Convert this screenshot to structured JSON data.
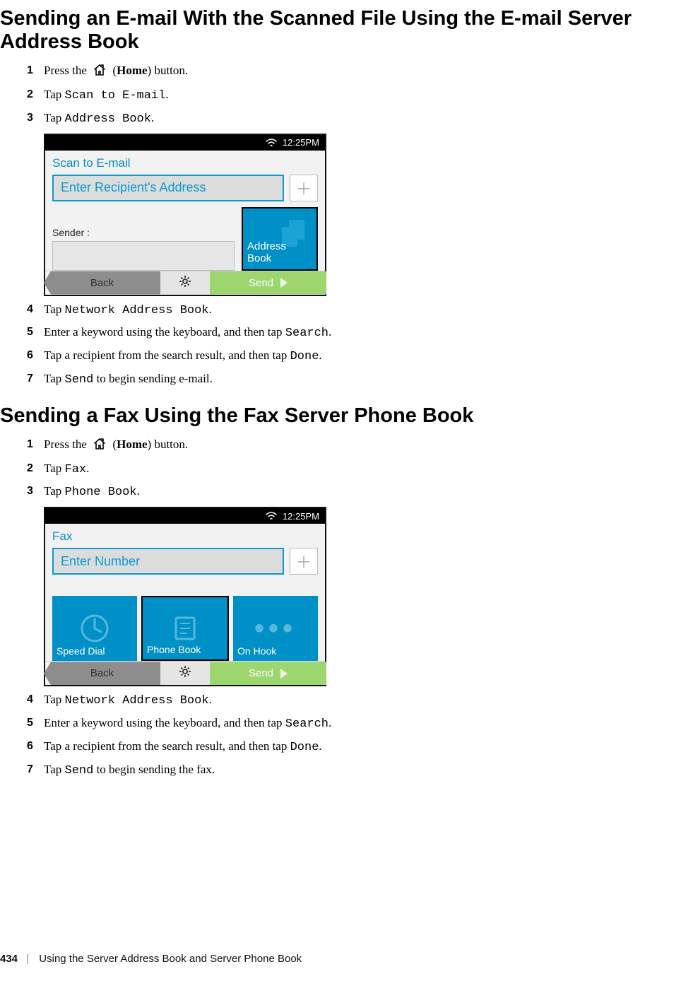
{
  "section1": {
    "title": "Sending an E-mail With the Scanned File Using the E-mail Server Address Book",
    "steps": {
      "s1": {
        "n": "1",
        "pre": "Press the ",
        "home": "Home",
        "post": ") button."
      },
      "s2": {
        "n": "2",
        "tap": "Tap ",
        "code": "Scan to E-mail",
        "dot": "."
      },
      "s3": {
        "n": "3",
        "tap": "Tap ",
        "code": "Address Book",
        "dot": "."
      },
      "s4": {
        "n": "4",
        "tap": "Tap ",
        "code": "Network Address Book",
        "dot": "."
      },
      "s5": {
        "n": "5",
        "pre": "Enter a keyword using the keyboard, and then tap ",
        "code": "Search",
        "dot": "."
      },
      "s6": {
        "n": "6",
        "pre": "Tap a recipient from the search result, and then tap ",
        "code": "Done",
        "dot": "."
      },
      "s7": {
        "n": "7",
        "tap": "Tap ",
        "code": "Send",
        "post": " to begin sending e-mail."
      }
    }
  },
  "ui1": {
    "time": "12:25PM",
    "screen_title": "Scan to E-mail",
    "recipient_placeholder": "Enter Recipient's Address",
    "sender_label": "Sender :",
    "address_book": "Address\nBook",
    "back": "Back",
    "send": "Send"
  },
  "section2": {
    "title": "Sending a Fax Using the Fax Server Phone Book",
    "steps": {
      "s1": {
        "n": "1",
        "pre": "Press the ",
        "home": "Home",
        "post": ") button."
      },
      "s2": {
        "n": "2",
        "tap": "Tap ",
        "code": "Fax",
        "dot": "."
      },
      "s3": {
        "n": "3",
        "tap": "Tap ",
        "code": "Phone Book",
        "dot": "."
      },
      "s4": {
        "n": "4",
        "tap": "Tap ",
        "code": "Network Address Book",
        "dot": "."
      },
      "s5": {
        "n": "5",
        "pre": "Enter a keyword using the keyboard, and then tap ",
        "code": "Search",
        "dot": "."
      },
      "s6": {
        "n": "6",
        "pre": "Tap a recipient from the search result, and then tap ",
        "code": "Done",
        "dot": "."
      },
      "s7": {
        "n": "7",
        "tap": "Tap ",
        "code": "Send",
        "post": " to begin sending the fax."
      }
    }
  },
  "ui2": {
    "time": "12:25PM",
    "screen_title": "Fax",
    "number_placeholder": "Enter Number",
    "speed_dial": "Speed Dial",
    "phone_book": "Phone Book",
    "on_hook": "On Hook",
    "back": "Back",
    "send": "Send"
  },
  "footer": {
    "page_num": "434",
    "chapter": "Using the Server Address Book and Server Phone Book"
  }
}
